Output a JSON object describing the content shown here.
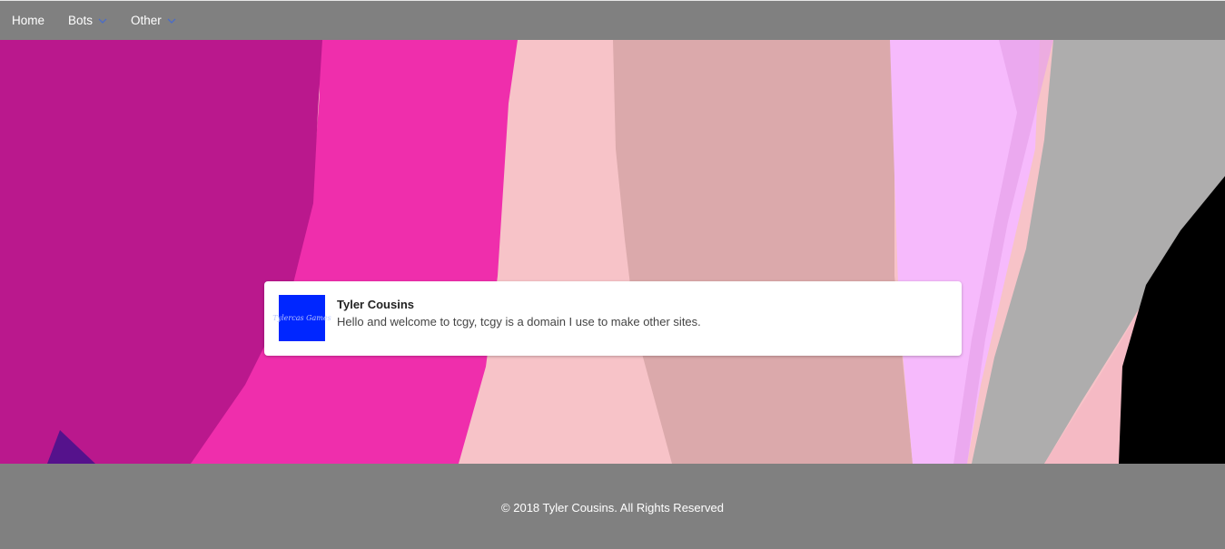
{
  "nav": {
    "items": [
      {
        "label": "Home",
        "has_dropdown": false
      },
      {
        "label": "Bots",
        "has_dropdown": true
      },
      {
        "label": "Other",
        "has_dropdown": true
      }
    ]
  },
  "card": {
    "name": "Tyler Cousins",
    "description": "Hello and welcome to tcgy, tcgy is a domain I use to make other sites.",
    "logo_text": "Tylercas Games",
    "logo_color": "#0026ff"
  },
  "footer": {
    "text": "© 2018 Tyler Cousins. All Rights Reserved"
  },
  "colors": {
    "bar": "#808080",
    "chevron": "#4a6cc9"
  }
}
